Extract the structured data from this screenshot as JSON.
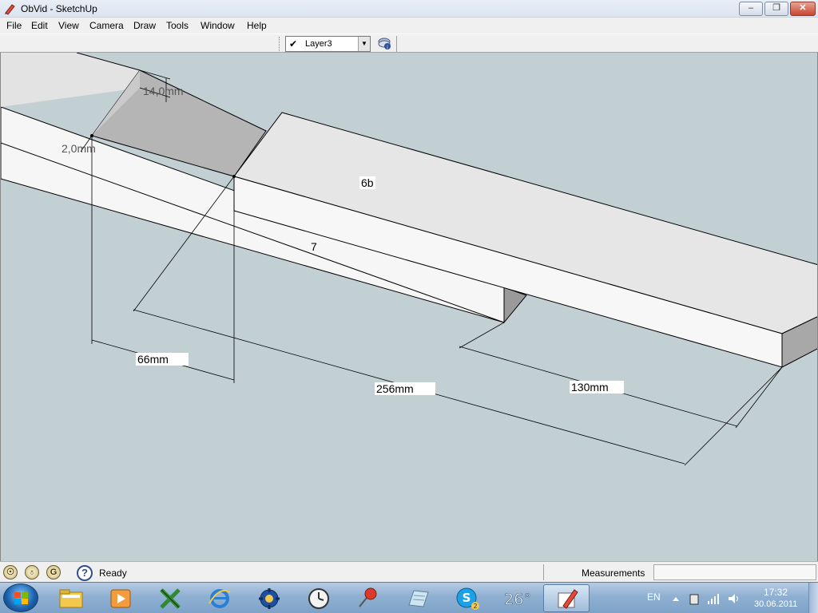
{
  "window": {
    "title": "ObVid - SketchUp",
    "minimize": "–",
    "maximize": "❐",
    "close": "✕"
  },
  "menu": [
    "File",
    "Edit",
    "View",
    "Camera",
    "Draw",
    "Tools",
    "Window",
    "Help"
  ],
  "toolbar": {
    "layer_check": "✔",
    "layer_name": "Layer3",
    "layer_arrow": "▼"
  },
  "model": {
    "labels": {
      "height_dim": "14,0mm",
      "offset_dim": "2,0mm",
      "part_6b": "6b",
      "part_7": "7",
      "dim_66": "66mm",
      "dim_256": "256mm",
      "dim_130": "130mm"
    }
  },
  "statusbar": {
    "status": "Ready",
    "measurements_label": "Measurements",
    "measurements_value": "",
    "geo_icon": "☉",
    "credits_icon": "♁",
    "user_icon": "G",
    "help_icon": "?"
  },
  "taskbar": {
    "items": [
      "file-explorer",
      "media-player",
      "xming",
      "internet-explorer",
      "settings-app",
      "clock-app",
      "pin-app",
      "notes-app",
      "skype",
      "weather-gadget",
      "sketchup"
    ],
    "weather_text": "26°",
    "skype_badge": "2",
    "language": "EN",
    "time": "17:32",
    "date": "30.06.2011"
  },
  "colors": {
    "viewport_bg": "#c2cfd3",
    "face_top": "#e3e3e3",
    "face_front": "#f6f6f6",
    "face_shadow": "#b5b5b5",
    "edge": "#000000"
  }
}
